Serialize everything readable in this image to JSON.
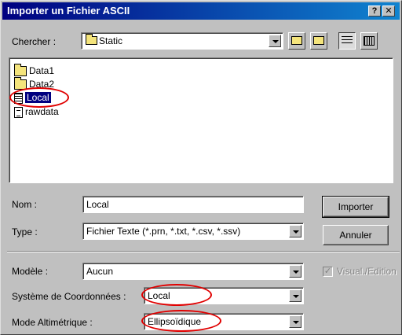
{
  "window": {
    "title": "Importer un Fichier  ASCII",
    "help_glyph": "?",
    "close_glyph": "✕"
  },
  "lookin": {
    "label": "Chercher :",
    "value": "Static"
  },
  "files": [
    {
      "name": "Data1",
      "icon": "folder-icon"
    },
    {
      "name": "Data2",
      "icon": "folder-icon"
    },
    {
      "name": "Local",
      "icon": "grid-file-icon",
      "selected": true
    },
    {
      "name": "rawdata",
      "icon": "text-file-icon"
    }
  ],
  "filename": {
    "label": "Nom :",
    "value": "Local"
  },
  "filetype": {
    "label": "Type :",
    "value": "Fichier Texte (*.prn, *.txt, *.csv, *.ssv)"
  },
  "buttons": {
    "import": "Importer",
    "cancel": "Annuler"
  },
  "model": {
    "label": "Modèle :",
    "value": "Aucun"
  },
  "visual_edition": {
    "label": "Visual./Edition",
    "checked": true,
    "enabled": false
  },
  "coord_system": {
    "label": "Système de Coordonnées :",
    "value": "Local"
  },
  "altimetric": {
    "label": "Mode Altimétrique :",
    "value": "Ellipsoïdique"
  },
  "colors": {
    "title_start": "#000080",
    "title_end": "#1084d0",
    "selection": "#000080",
    "highlight_circle": "#e00000"
  }
}
